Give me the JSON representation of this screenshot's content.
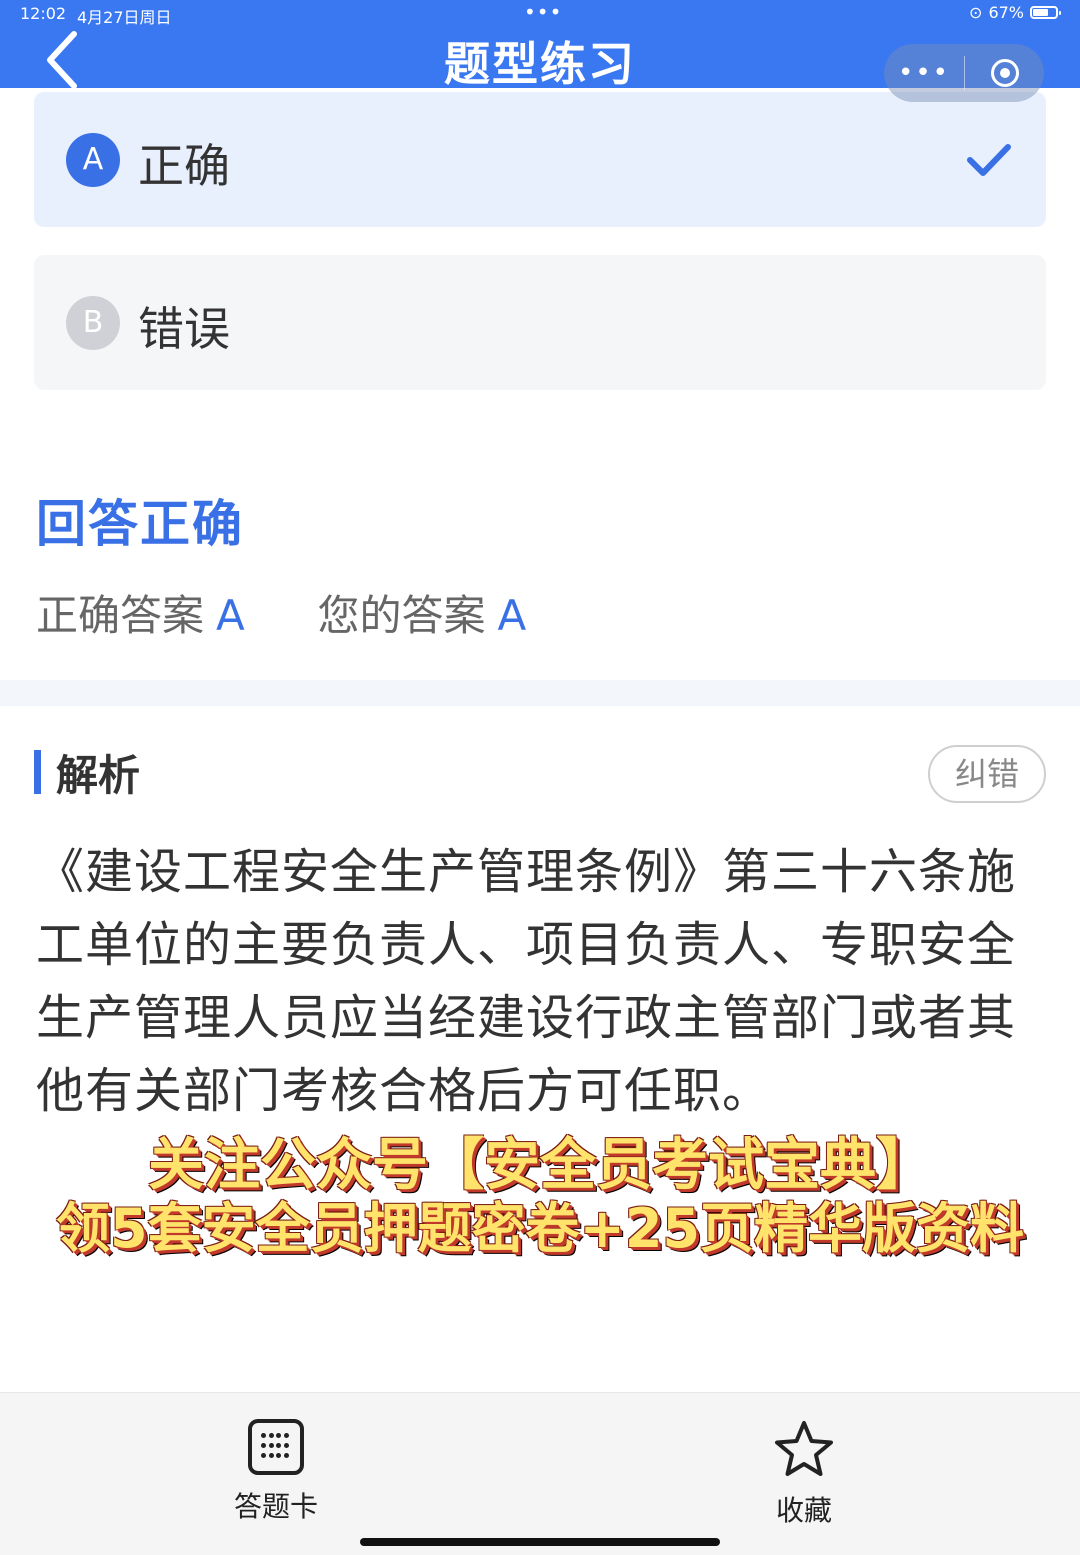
{
  "status_bar": {
    "time": "12:02",
    "date": "4月27日周日",
    "battery": "67%"
  },
  "header": {
    "title": "题型练习"
  },
  "options": [
    {
      "letter": "A",
      "text": "正确",
      "selected": true
    },
    {
      "letter": "B",
      "text": "错误",
      "selected": false
    }
  ],
  "result": {
    "title": "回答正确",
    "correct_label": "正确答案",
    "correct_value": "A",
    "yours_label": "您的答案",
    "yours_value": "A"
  },
  "analysis": {
    "title": "解析",
    "report_label": "纠错",
    "text": "《建设工程安全生产管理条例》第三十六条施工单位的主要负责人、项目负责人、专职安全生产管理人员应当经建设行政主管部门或者其他有关部门考核合格后方可任职。"
  },
  "promo": {
    "line1": "关注公众号【安全员考试宝典】",
    "line2": "领5套安全员押题密卷+25页精华版资料"
  },
  "bottom_bar": {
    "answer_card_label": "答题卡",
    "favorite_label": "收藏"
  },
  "colors": {
    "brand": "#3a78f2",
    "accent": "#3a70e6",
    "selected_bg": "#e8effd"
  }
}
